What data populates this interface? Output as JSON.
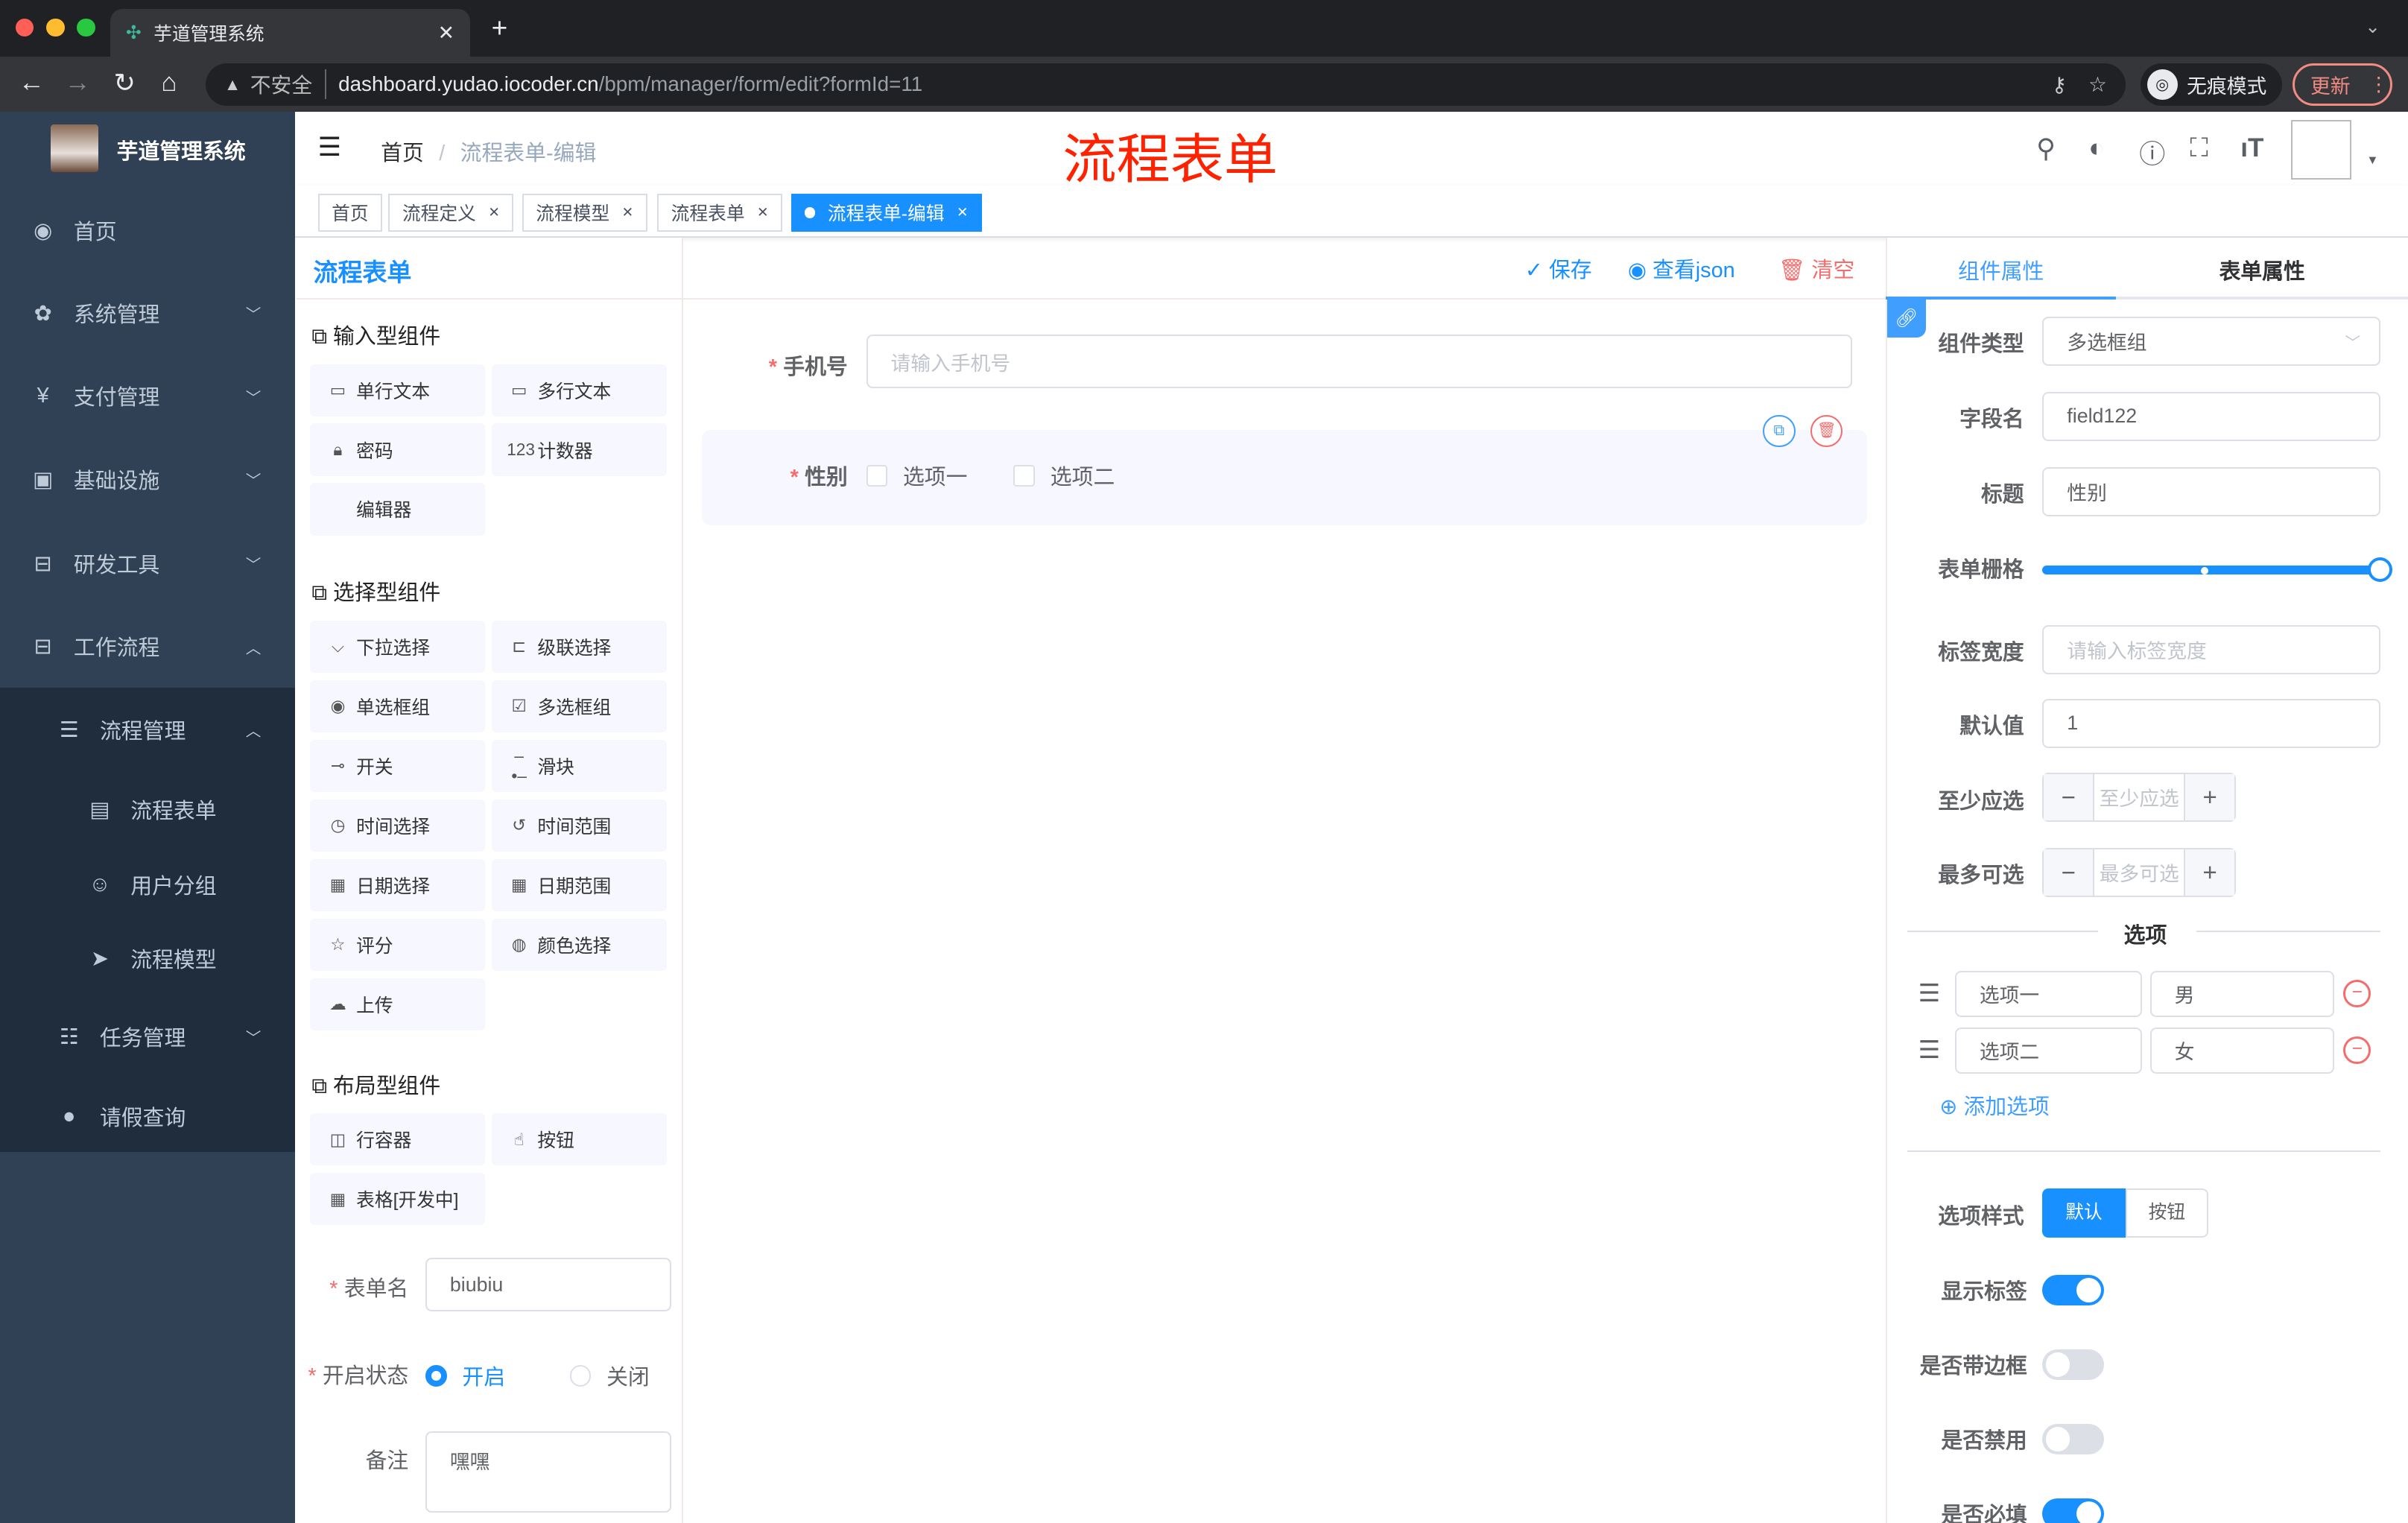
{
  "browser": {
    "tab_title": "芋道管理系统",
    "security_label": "不安全",
    "url_host": "dashboard.yudao.iocoder.cn",
    "url_path": "/bpm/manager/form/edit?formId=11",
    "incognito_label": "无痕模式",
    "update_label": "更新"
  },
  "sidebar": {
    "app_name": "芋道管理系统",
    "items": [
      {
        "label": "首页",
        "icon": "dashboard-icon",
        "glyph": "◉"
      },
      {
        "label": "系统管理",
        "icon": "gear-icon",
        "glyph": "✿",
        "chevron": "﹀"
      },
      {
        "label": "支付管理",
        "icon": "yen-icon",
        "glyph": "¥",
        "chevron": "﹀"
      },
      {
        "label": "基础设施",
        "icon": "monitor-icon",
        "glyph": "▣",
        "chevron": "﹀"
      },
      {
        "label": "研发工具",
        "icon": "toolbox-icon",
        "glyph": "⊟",
        "chevron": "﹀"
      },
      {
        "label": "工作流程",
        "icon": "toolbox-icon",
        "glyph": "⊟",
        "chevron": "︿"
      }
    ],
    "sub_items": [
      {
        "label": "流程管理",
        "icon": "tree-icon",
        "glyph": "☰",
        "chevron": "︿",
        "level": 1
      },
      {
        "label": "流程表单",
        "icon": "form-icon",
        "glyph": "▤",
        "level": 2
      },
      {
        "label": "用户分组",
        "icon": "group-icon",
        "glyph": "☺",
        "level": 2
      },
      {
        "label": "流程模型",
        "icon": "send-icon",
        "glyph": "➤",
        "level": 2
      },
      {
        "label": "任务管理",
        "icon": "tree-icon",
        "glyph": "☷",
        "chevron": "﹀",
        "level": 1
      },
      {
        "label": "请假查询",
        "icon": "user-icon",
        "glyph": "●",
        "level": 1
      }
    ]
  },
  "navbar": {
    "breadcrumb": [
      "首页",
      "流程表单-编辑"
    ],
    "page_heading": "流程表单"
  },
  "tags": [
    {
      "label": "首页",
      "closable": false
    },
    {
      "label": "流程定义",
      "closable": true
    },
    {
      "label": "流程模型",
      "closable": true
    },
    {
      "label": "流程表单",
      "closable": true
    },
    {
      "label": "流程表单-编辑",
      "closable": true,
      "active": true
    }
  ],
  "left_panel": {
    "title": "流程表单",
    "groups": [
      {
        "title": "输入型组件",
        "items": [
          {
            "label": "单行文本",
            "glyph": "▭"
          },
          {
            "label": "多行文本",
            "glyph": "▭"
          },
          {
            "label": "密码",
            "glyph": "🔒︎"
          },
          {
            "label": "计数器",
            "glyph": "123"
          },
          {
            "label": "编辑器",
            "glyph": ""
          }
        ]
      },
      {
        "title": "选择型组件",
        "items": [
          {
            "label": "下拉选择",
            "glyph": "⌵"
          },
          {
            "label": "级联选择",
            "glyph": "⊏"
          },
          {
            "label": "单选框组",
            "glyph": "◉"
          },
          {
            "label": "多选框组",
            "glyph": "☑"
          },
          {
            "label": "开关",
            "glyph": "⊸"
          },
          {
            "label": "滑块",
            "glyph": "–•–"
          },
          {
            "label": "时间选择",
            "glyph": "◷"
          },
          {
            "label": "时间范围",
            "glyph": "↺"
          },
          {
            "label": "日期选择",
            "glyph": "▦"
          },
          {
            "label": "日期范围",
            "glyph": "▦"
          },
          {
            "label": "评分",
            "glyph": "☆"
          },
          {
            "label": "颜色选择",
            "glyph": "◍"
          },
          {
            "label": "上传",
            "glyph": "☁"
          }
        ]
      },
      {
        "title": "布局型组件",
        "items": [
          {
            "label": "行容器",
            "glyph": "◫"
          },
          {
            "label": "按钮",
            "glyph": "☝"
          },
          {
            "label": "表格[开发中]",
            "glyph": "▦"
          }
        ]
      }
    ],
    "form": {
      "name_label": "表单名",
      "name_value": "biubiu",
      "status_label": "开启状态",
      "status_on": "开启",
      "status_off": "关闭",
      "status_selected": "开启",
      "remark_label": "备注",
      "remark_value": "嘿嘿"
    }
  },
  "toolbar": {
    "save": "保存",
    "view_json": "查看json",
    "clear": "清空"
  },
  "canvas": {
    "phone_label": "手机号",
    "phone_placeholder": "请输入手机号",
    "gender_label": "性别",
    "options": [
      "选项一",
      "选项二"
    ]
  },
  "right_panel": {
    "tabs": [
      "组件属性",
      "表单属性"
    ],
    "active_tab": "组件属性",
    "component_type_label": "组件类型",
    "component_type": "多选框组",
    "field_label": "字段名",
    "field_value": "field122",
    "title_label": "标题",
    "title_value": "性别",
    "grid_label": "表单栅格",
    "grid_value": 24,
    "grid_max": 24,
    "label_width_label": "标签宽度",
    "label_width_placeholder": "请输入标签宽度",
    "default_label": "默认值",
    "default_value": "1",
    "min_label": "至少应选",
    "min_placeholder": "至少应选",
    "max_label": "最多可选",
    "max_placeholder": "最多可选",
    "options_divider": "选项",
    "options": [
      {
        "label": "选项一",
        "value": "男"
      },
      {
        "label": "选项二",
        "value": "女"
      }
    ],
    "add_option": "添加选项",
    "style_label": "选项样式",
    "style_options": [
      "默认",
      "按钮"
    ],
    "style_selected": "默认",
    "switches": [
      {
        "label": "显示标签",
        "on": true
      },
      {
        "label": "是否带边框",
        "on": false
      },
      {
        "label": "是否禁用",
        "on": false
      },
      {
        "label": "是否必填",
        "on": true
      }
    ]
  },
  "colors": {
    "primary": "#1890ff",
    "sidebar": "#304156",
    "submenu": "#1f2d3d",
    "heading_red": "#ff2200",
    "danger": "#f56c6c"
  }
}
